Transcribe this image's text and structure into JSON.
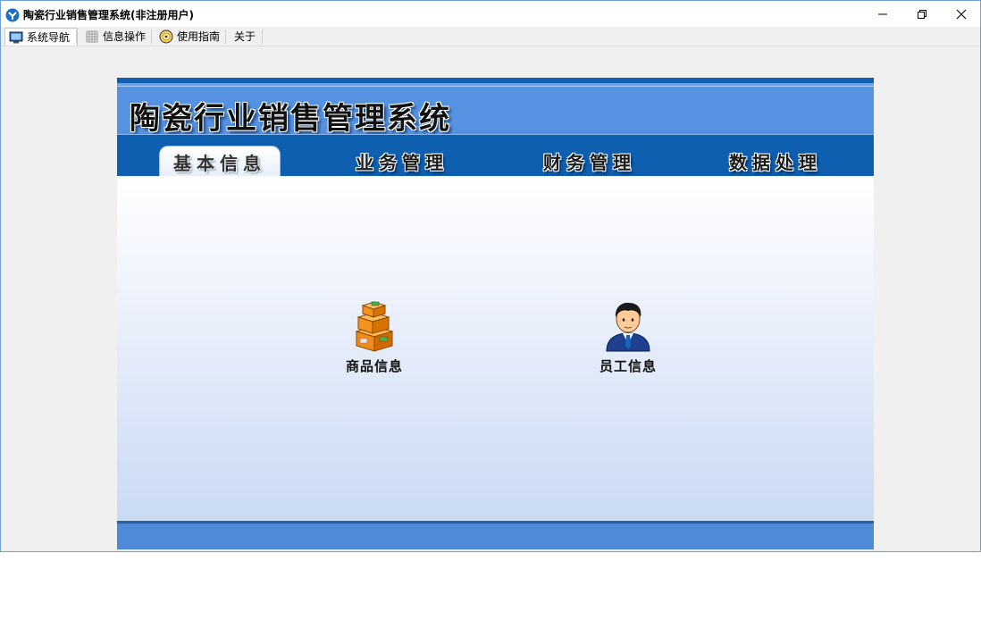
{
  "window": {
    "title": "陶瓷行业销售管理系统(非注册用户)",
    "controls": [
      "minimize",
      "restore",
      "close"
    ]
  },
  "menubar": {
    "items": [
      {
        "label": "系统导航",
        "icon": "monitor-icon",
        "active": true
      },
      {
        "label": "信息操作",
        "icon": "grid-icon",
        "active": false
      },
      {
        "label": "使用指南",
        "icon": "help-disc-icon",
        "active": false
      },
      {
        "label": "关于",
        "icon": "",
        "active": false
      }
    ]
  },
  "banner": {
    "title": "陶瓷行业销售管理系统"
  },
  "tabs": [
    {
      "label": "基本信息",
      "active": true
    },
    {
      "label": "业务管理",
      "active": false
    },
    {
      "label": "财务管理",
      "active": false
    },
    {
      "label": "数据处理",
      "active": false
    }
  ],
  "tiles": [
    {
      "label": "商品信息",
      "icon": "boxes-icon"
    },
    {
      "label": "员工信息",
      "icon": "employee-icon"
    }
  ],
  "colors": {
    "banner_blue": "#5592e2",
    "tabbar_blue": "#0f5fb0",
    "footer_blue": "#4f8ad8"
  }
}
